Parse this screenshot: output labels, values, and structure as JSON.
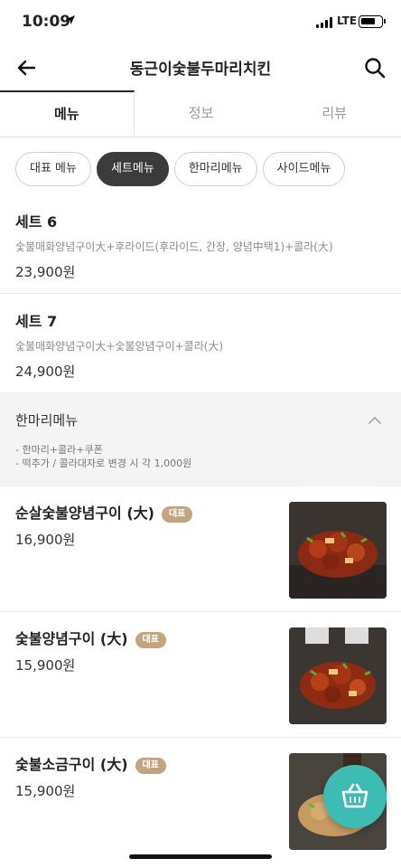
{
  "status": {
    "time": "10:09",
    "network": "LTE",
    "battery_level": 0.75,
    "signal_bars": 4
  },
  "header": {
    "title": "동근이숯불두마리치킨"
  },
  "tabs": [
    {
      "label": "메뉴",
      "active": true
    },
    {
      "label": "정보",
      "active": false
    },
    {
      "label": "리뷰",
      "active": false
    }
  ],
  "chips": [
    {
      "label": "대표 메뉴",
      "active": false
    },
    {
      "label": "세트메뉴",
      "active": true
    },
    {
      "label": "한마리메뉴",
      "active": false
    },
    {
      "label": "사이드메뉴",
      "active": false
    }
  ],
  "set_items": [
    {
      "name": "세트 6",
      "desc": "숯불매화양념구이大+후라이드(후라이드, 간장, 양념中택1)+콜라(大)",
      "price": "23,900원"
    },
    {
      "name": "세트 7",
      "desc": "숯불매화양념구이大+숯불양념구이+콜라(大)",
      "price": "24,900원"
    }
  ],
  "section": {
    "title": "한마리메뉴",
    "notes": [
      "- 한마리+콜라+쿠폰",
      "- 떡추가 / 콜라대자로 변경 시 각 1,000원"
    ]
  },
  "menu_items": [
    {
      "name": "순살숯불양념구이 (大)",
      "badge": "대표",
      "price": "16,900원",
      "image": "chicken-photo"
    },
    {
      "name": "숯불양념구이 (大)",
      "badge": "대표",
      "price": "15,900원",
      "image": "chicken-photo"
    },
    {
      "name": "숯불소금구이 (大)",
      "badge": "대표",
      "price": "15,900원",
      "image": "chicken-photo"
    }
  ],
  "colors": {
    "accent": "#3dbcb4",
    "badge": "#c4a381",
    "chip_active": "#3b3b3b"
  },
  "icons": [
    "back-arrow-icon",
    "search-icon",
    "chevron-up-icon",
    "cart-icon",
    "location-arrow-icon"
  ]
}
